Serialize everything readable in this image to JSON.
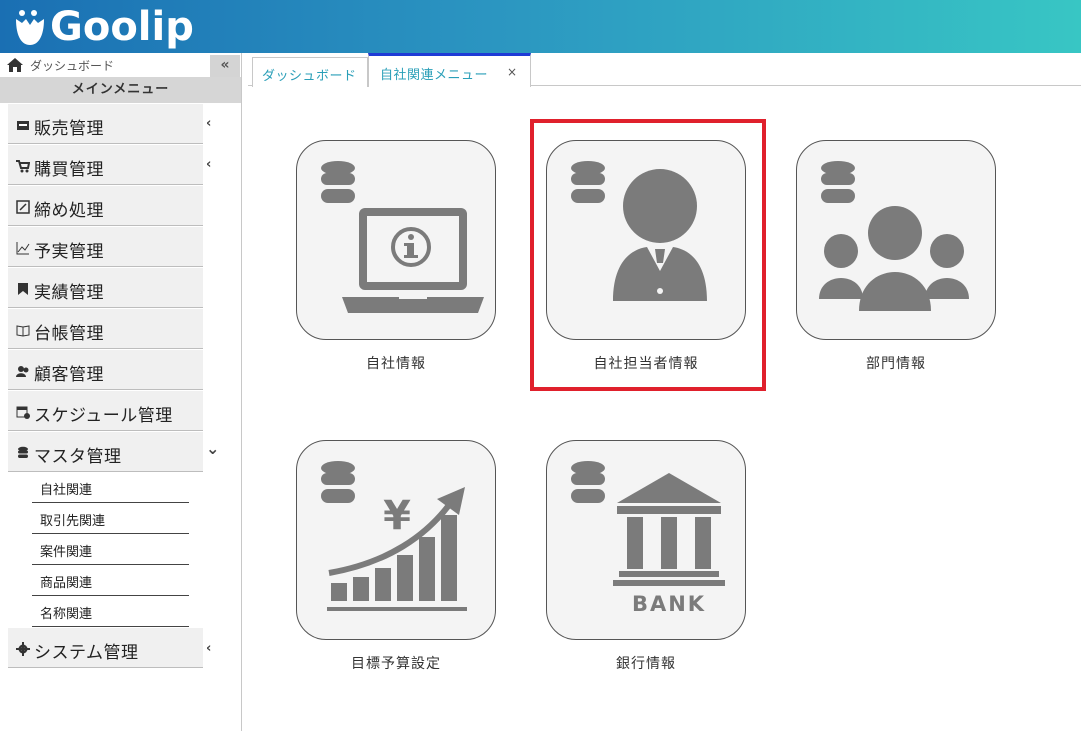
{
  "brand": {
    "name": "Goolip"
  },
  "sidebar": {
    "dashboard_label": "ダッシュボード",
    "collapse_glyph": "«",
    "menu_header": "メインメニュー",
    "items": [
      {
        "label": "販売管理",
        "icon": "register-icon",
        "arrow": "‹"
      },
      {
        "label": "購買管理",
        "icon": "cart-icon",
        "arrow": "‹"
      },
      {
        "label": "締め処理",
        "icon": "closing-icon",
        "arrow": ""
      },
      {
        "label": "予実管理",
        "icon": "line-chart-icon",
        "arrow": ""
      },
      {
        "label": "実績管理",
        "icon": "bookmark-icon",
        "arrow": ""
      },
      {
        "label": "台帳管理",
        "icon": "book-icon",
        "arrow": ""
      },
      {
        "label": "顧客管理",
        "icon": "users-icon",
        "arrow": ""
      },
      {
        "label": "スケジュール管理",
        "icon": "calendar-icon",
        "arrow": ""
      },
      {
        "label": "マスタ管理",
        "icon": "database-icon",
        "arrow": "⌄"
      }
    ],
    "sub_items": [
      {
        "label": "自社関連"
      },
      {
        "label": "取引先関連"
      },
      {
        "label": "案件関連"
      },
      {
        "label": "商品関連"
      },
      {
        "label": "名称関連"
      }
    ],
    "system": {
      "label": "システム管理",
      "icon": "gear-icon",
      "arrow": "‹"
    }
  },
  "tabs": [
    {
      "label": "ダッシュボード"
    },
    {
      "label": "自社関連メニュー",
      "close": "×"
    }
  ],
  "tiles": [
    {
      "label": "自社情報",
      "icon": "laptop-info-icon"
    },
    {
      "label": "自社担当者情報",
      "icon": "person-icon"
    },
    {
      "label": "部門情報",
      "icon": "group-icon"
    },
    {
      "label": "目標予算設定",
      "icon": "yen-growth-icon"
    },
    {
      "label": "銀行情報",
      "icon": "bank-icon",
      "bank_text": "BANK"
    }
  ],
  "colors": {
    "accent": "#2a9fb8",
    "highlight": "#e0202c",
    "tab_active": "#1f3bd6",
    "icon_gray": "#7b7b7b"
  }
}
